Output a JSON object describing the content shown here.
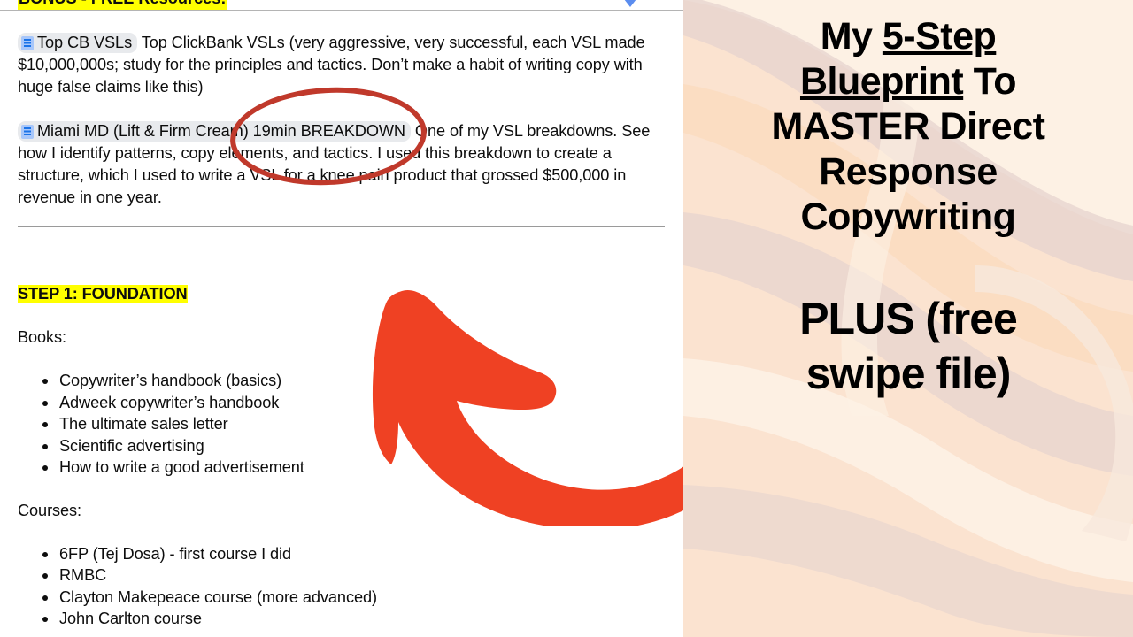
{
  "document": {
    "bonus_heading": "BONUS - FREE Resources!",
    "chip1": {
      "icon": "google-docs-icon",
      "label": "Top CB VSLs"
    },
    "para1": "Top ClickBank VSLs (very aggressive, very successful, each VSL made $10,000,000s; study for the principles and tactics. Don’t make a habit of writing copy with huge false claims like this)",
    "chip2": {
      "icon": "google-docs-icon",
      "label": "Miami MD (Lift & Firm Cream) 19min BREAKDOWN"
    },
    "para2": "One of my VSL breakdowns. See how I identify patterns, copy elements, and tactics. I used this breakdown to create a structure, which I used to write a VSL for a knee pain product that grossed $500,000 in revenue in one year.",
    "step_heading": "STEP 1: FOUNDATION",
    "books_label": "Books:",
    "books": [
      "Copywriter’s handbook (basics)",
      "Adweek copywriter’s handbook",
      "The ultimate sales letter",
      "Scientific advertising",
      "How to write a good advertisement"
    ],
    "courses_label": "Courses:",
    "courses": [
      "6FP (Tej Dosa) - first course I did",
      "RMBC",
      "Clayton Makepeace course (more advanced)",
      "John Carlton course"
    ]
  },
  "annotations": {
    "circle_color": "#c0392b",
    "arrow_color": "#ef4123",
    "highlight_color": "#ffff00",
    "indent_marker_color": "#5b8def"
  },
  "panel": {
    "title_lines": [
      {
        "pre": "My ",
        "underlined": "5-Step",
        "post": ""
      },
      {
        "pre": "",
        "underlined": "Blueprint",
        "post": " To"
      },
      {
        "pre": "MASTER Direct",
        "underlined": "",
        "post": ""
      },
      {
        "pre": "Response",
        "underlined": "",
        "post": ""
      },
      {
        "pre": "Copywriting",
        "underlined": "",
        "post": ""
      }
    ],
    "subtitle_lines": [
      "PLUS (free",
      "swipe file)"
    ],
    "colors": {
      "base": "#fbe3d0",
      "cream": "#fdf1e4",
      "pink": "#e6d3cf",
      "peach": "#fadcc0",
      "light": "#f7e8dc"
    }
  }
}
